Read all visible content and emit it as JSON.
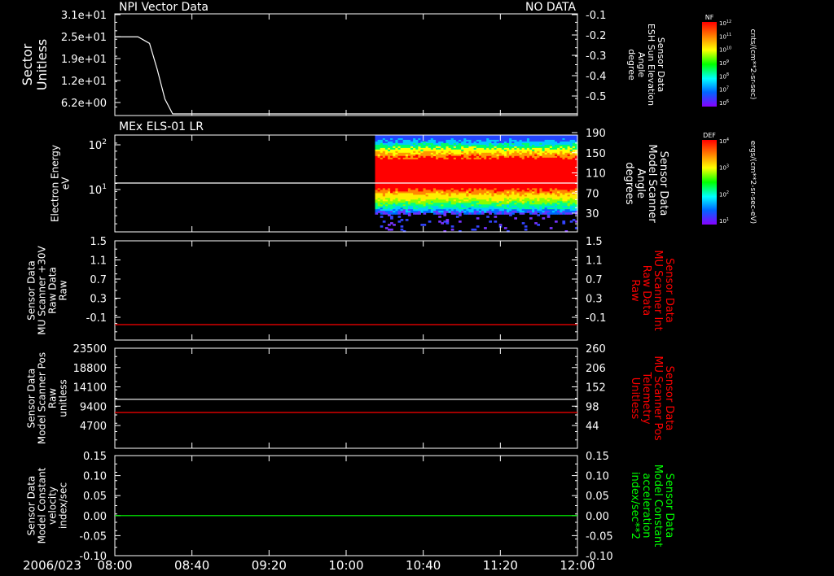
{
  "colors": {
    "white": "#ffffff",
    "red": "#ff0000",
    "green": "#00ff00",
    "background": "#000000"
  },
  "chart_data": [
    {
      "type": "line",
      "title": "NPI Vector Data",
      "status": "NO DATA",
      "ylabel": [
        "Sector",
        "Unitless"
      ],
      "yticks": [
        "3.1e+01",
        "2.5e+01",
        "1.9e+01",
        "1.2e+01",
        "6.2e+00"
      ],
      "ylim": [
        0,
        31
      ],
      "y2label": [
        "Sensor Data",
        "ESH Sun Elevation",
        "Angle",
        "degree"
      ],
      "y2ticks": [
        "-0.1",
        "-0.2",
        "-0.3",
        "-0.4",
        "-0.5"
      ],
      "series": [
        {
          "color": "#ffffff",
          "x": [
            "08:00",
            "08:12",
            "08:18",
            "08:22",
            "08:26",
            "08:30",
            "12:00"
          ],
          "y": [
            24,
            24,
            22,
            14,
            5,
            0.5,
            0.5
          ]
        }
      ]
    },
    {
      "type": "heatmap",
      "title": "MEx ELS-01 LR",
      "ylabel": [
        "Electron Energy",
        "eV"
      ],
      "yticks": [
        "10^2",
        "10^1"
      ],
      "scale": "log",
      "y2label": [
        "Sensor Data",
        "Model Scanner",
        "Angle",
        "degrees"
      ],
      "y2ticks": [
        "190",
        "150",
        "110",
        "70",
        "30"
      ],
      "data_start": "10:15",
      "line": {
        "color": "#ffffff",
        "y": 14
      },
      "colorbar": {
        "label": "DEF",
        "units": "ergs/(cm**2-sr-sec-eV)",
        "ticks": [
          "10^4",
          "10^3",
          "10^2",
          "10^1"
        ]
      }
    },
    {
      "type": "line",
      "ylabel": [
        "Sensor Data",
        "MU Scanner +30V",
        "Raw Data",
        "Raw"
      ],
      "yticks": [
        "1.5",
        "1.1",
        "0.7",
        "0.3",
        "-0.1"
      ],
      "ylim": [
        -0.3,
        1.5
      ],
      "y2label": [
        "Sensor Data",
        "MU Scanner Int",
        "Raw Data",
        "Raw"
      ],
      "y2ticks": [
        "1.5",
        "1.1",
        "0.7",
        "0.3",
        "-0.1"
      ],
      "series": [
        {
          "color": "#ff0000",
          "x": [
            "08:00",
            "12:00"
          ],
          "y": [
            -0.02,
            -0.02
          ]
        }
      ]
    },
    {
      "type": "line",
      "ylabel": [
        "Sensor Data",
        "Model Scanner Pos",
        "Raw",
        "unitless"
      ],
      "yticks": [
        "23500",
        "18800",
        "14100",
        "9400",
        "4700"
      ],
      "ylim": [
        0,
        23500
      ],
      "y2label": [
        "Sensor Data",
        "MU Scanner Pos",
        "Telemetry",
        "Unitless"
      ],
      "y2ticks": [
        "260",
        "206",
        "152",
        "98",
        "44"
      ],
      "series": [
        {
          "color": "#ffffff",
          "x": [
            "08:00",
            "12:00"
          ],
          "y": [
            11500,
            11500
          ]
        },
        {
          "color": "#ff0000",
          "x": [
            "08:00",
            "12:00"
          ],
          "y": [
            8400,
            8400
          ]
        }
      ]
    },
    {
      "type": "line",
      "ylabel": [
        "Sensor Data",
        "Model Constant",
        "velocity",
        "index/sec"
      ],
      "yticks": [
        "0.15",
        "0.10",
        "0.05",
        "0.00",
        "-0.05",
        "-0.10"
      ],
      "ylim": [
        -0.1,
        0.15
      ],
      "y2label": [
        "Sensor Data",
        "Model Constant",
        "acceleration",
        "index/sec**2"
      ],
      "y2ticks": [
        "0.15",
        "0.10",
        "0.05",
        "0.00",
        "-0.05",
        "-0.10"
      ],
      "series": [
        {
          "color": "#00ff00",
          "x": [
            "08:00",
            "12:00"
          ],
          "y": [
            0,
            0
          ]
        }
      ]
    }
  ],
  "xaxis": {
    "date": "2006/023",
    "ticks": [
      "08:00",
      "08:40",
      "09:20",
      "10:00",
      "10:40",
      "11:20",
      "12:00"
    ]
  },
  "colorbar_nf": {
    "label": "NF",
    "units": "cnts/(cm**2-sr-sec)",
    "ticks": [
      "10^12",
      "10^11",
      "10^10",
      "10^9",
      "10^8",
      "10^7",
      "10^6"
    ]
  }
}
